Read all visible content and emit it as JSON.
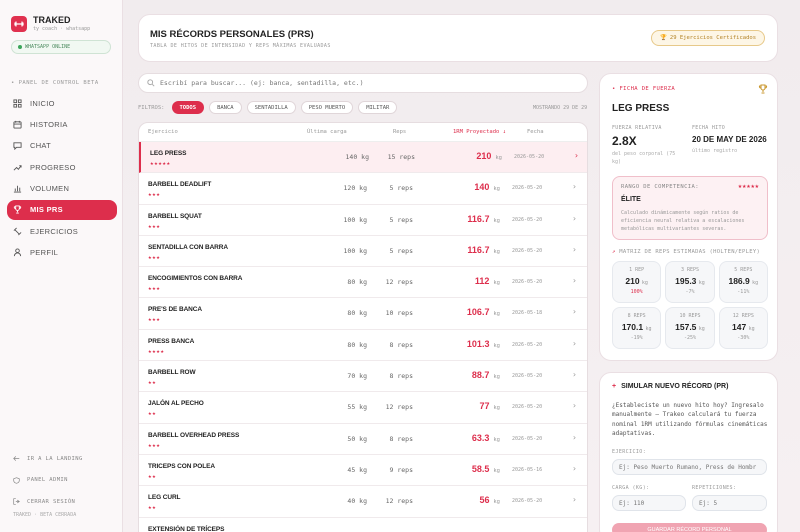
{
  "brand": {
    "name": "TRAKED",
    "sub": "ty coach · whatsapp"
  },
  "sidebar": {
    "whatsapp": "WHATSAPP ONLINE",
    "section": "PANEL DE CONTROL BETA",
    "items": [
      {
        "label": "INICIO",
        "icon": "grid-icon"
      },
      {
        "label": "HISTORIA",
        "icon": "calendar-icon"
      },
      {
        "label": "CHAT",
        "icon": "chat-icon"
      },
      {
        "label": "PROGRESO",
        "icon": "trend-icon"
      },
      {
        "label": "VOLUMEN",
        "icon": "bar-chart-icon"
      },
      {
        "label": "MIS PRS",
        "icon": "trophy-icon",
        "active": true
      },
      {
        "label": "EJERCICIOS",
        "icon": "dumbbell-icon"
      },
      {
        "label": "PERFIL",
        "icon": "user-icon"
      }
    ],
    "bottom": [
      "IR A LA LANDING",
      "PANEL ADMIN",
      "CERRAR SESIÓN"
    ],
    "footer": "TRAKED · BETA CERRADA"
  },
  "header": {
    "title": "MIS RÉCORDS PERSONALES (PRS)",
    "subtitle": "TABLA DE HITOS DE INTENSIDAD Y REPS MÁXIMAS EVALUADAS",
    "badge": "29 Ejercicios Certificados"
  },
  "search": {
    "placeholder": "Escribí para buscar... (ej: banca, sentadilla, etc.)"
  },
  "filters": {
    "label": "FILTROS:",
    "chips": [
      "TODOS",
      "BANCA",
      "SENTADILLA",
      "PESO MUERTO",
      "MILITAR"
    ],
    "active": "TODOS",
    "showing": "MOSTRANDO 29 DE 29"
  },
  "table": {
    "headers": {
      "exercise": "Ejercicio",
      "load": "Última carga",
      "reps": "Reps",
      "orm": "1RM Proyectado ↓",
      "date": "Fecha"
    },
    "rows": [
      {
        "name": "LEG PRESS",
        "stars": "★★★★★",
        "load": "140 kg",
        "reps": "15 reps",
        "orm": "210",
        "unit": "kg",
        "date": "2026-05-20",
        "selected": true
      },
      {
        "name": "BARBELL DEADLIFT",
        "stars": "★★★",
        "load": "120 kg",
        "reps": "5 reps",
        "orm": "140",
        "unit": "kg",
        "date": "2026-05-20"
      },
      {
        "name": "BARBELL SQUAT",
        "stars": "★★★",
        "load": "100 kg",
        "reps": "5 reps",
        "orm": "116.7",
        "unit": "kg",
        "date": "2026-05-20"
      },
      {
        "name": "SENTADILLA CON BARRA",
        "stars": "★★★",
        "load": "100 kg",
        "reps": "5 reps",
        "orm": "116.7",
        "unit": "kg",
        "date": "2026-05-20"
      },
      {
        "name": "ENCOGIMIENTOS CON BARRA",
        "stars": "★★★",
        "load": "80 kg",
        "reps": "12 reps",
        "orm": "112",
        "unit": "kg",
        "date": "2026-05-20"
      },
      {
        "name": "PRE'S DE BANCA",
        "stars": "★★★",
        "load": "80 kg",
        "reps": "10 reps",
        "orm": "106.7",
        "unit": "kg",
        "date": "2026-05-18"
      },
      {
        "name": "PRESS BANCA",
        "stars": "★★★★",
        "load": "80 kg",
        "reps": "8 reps",
        "orm": "101.3",
        "unit": "kg",
        "date": "2026-05-20"
      },
      {
        "name": "BARBELL ROW",
        "stars": "★★",
        "load": "70 kg",
        "reps": "8 reps",
        "orm": "88.7",
        "unit": "kg",
        "date": "2026-05-20"
      },
      {
        "name": "JALÓN AL PECHO",
        "stars": "★★",
        "load": "55 kg",
        "reps": "12 reps",
        "orm": "77",
        "unit": "kg",
        "date": "2026-05-20"
      },
      {
        "name": "BARBELL OVERHEAD PRESS",
        "stars": "★★★",
        "load": "50 kg",
        "reps": "8 reps",
        "orm": "63.3",
        "unit": "kg",
        "date": "2026-05-20"
      },
      {
        "name": "TRICEPS CON POLEA",
        "stars": "★★",
        "load": "45 kg",
        "reps": "9 reps",
        "orm": "58.5",
        "unit": "kg",
        "date": "2026-05-16"
      },
      {
        "name": "LEG CURL",
        "stars": "★★",
        "load": "40 kg",
        "reps": "12 reps",
        "orm": "56",
        "unit": "kg",
        "date": "2026-05-20"
      },
      {
        "name": "EXTENSIÓN DE TRÍCEPS",
        "stars": "",
        "load": "",
        "reps": "",
        "orm": "",
        "unit": "",
        "date": ""
      }
    ]
  },
  "ficha": {
    "tag": "FICHA DE FUERZA",
    "title": "LEG PRESS",
    "fuerza_label": "FUERZA RELATIVA",
    "fuerza_val": "2.8X",
    "fuerza_note": "del peso corporal (75 kg)",
    "fecha_label": "FECHA HITO",
    "fecha_val": "20 DE MAY DE 2026",
    "fecha_note": "último registro",
    "rango_label": "RANGO DE COMPETENCIA:",
    "rango_stars": "★★★★★",
    "rango_val": "ÉLITE",
    "rango_desc": "Calculado dinámicamente según ratios de eficiencia neural relativa a escalaciones metabólicas multivariantes severas.",
    "matrix_label": "MATRIZ DE REPS ESTIMADAS (HOLTEN/EPLEY)",
    "matrix": [
      {
        "reps": "1 REP",
        "val": "210",
        "pct": "100%",
        "hi": true
      },
      {
        "reps": "3 REPS",
        "val": "195.3",
        "pct": "-7%"
      },
      {
        "reps": "5 REPS",
        "val": "186.9",
        "pct": "-11%"
      },
      {
        "reps": "8 REPS",
        "val": "170.1",
        "pct": "-19%"
      },
      {
        "reps": "10 REPS",
        "val": "157.5",
        "pct": "-25%"
      },
      {
        "reps": "12 REPS",
        "val": "147",
        "pct": "-30%"
      }
    ],
    "unit": "kg"
  },
  "sim": {
    "title": "SIMULAR NUEVO RÉCORD (PR)",
    "desc": "¿Estableciste un nuevo hito hoy? Ingresalo manualmente — Trakeo calculará tu fuerza nominal 1RM utilizando fórmulas cinemáticas adaptativas.",
    "ex_label": "EJERCICIO:",
    "ex_placeholder": "Ej: Peso Muerto Rumano, Press de Hombr",
    "load_label": "CARGA (KG):",
    "load_placeholder": "Ej: 110",
    "reps_label": "REPETICIONES:",
    "reps_placeholder": "Ej: 5",
    "button": "GUARDAR RÉCORD PERSONAL"
  },
  "colors": {
    "accent": "#dd2e4c",
    "gold": "#b38224"
  }
}
